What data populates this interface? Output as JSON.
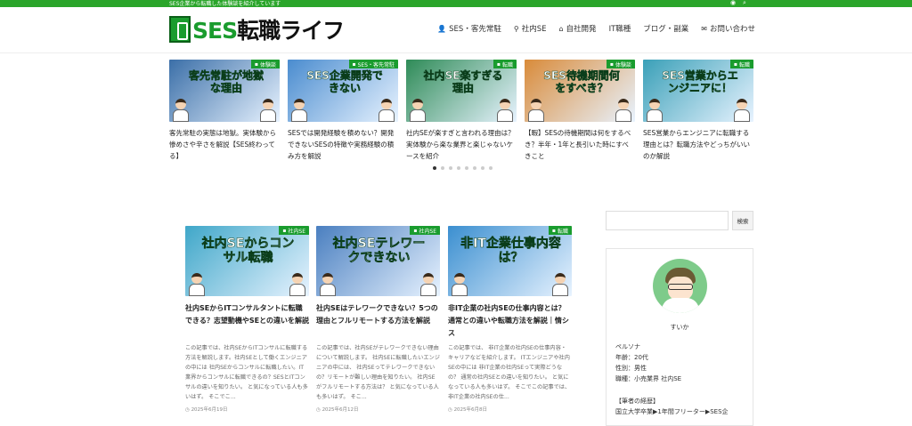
{
  "topbar": {
    "tagline": "SES企業から転職した体験談を紹介しています",
    "icons": [
      "rss-icon",
      "search-icon"
    ]
  },
  "header": {
    "logo_text": "SES転職ライフ",
    "nav": [
      {
        "label": "SES・客先常駐",
        "icon": "user-icon"
      },
      {
        "label": "社内SE",
        "icon": "pin-icon"
      },
      {
        "label": "自社開発",
        "icon": "home-icon"
      },
      {
        "label": "IT職種",
        "icon": ""
      },
      {
        "label": "ブログ・副業",
        "icon": ""
      },
      {
        "label": "お問い合わせ",
        "icon": "mail-icon"
      }
    ]
  },
  "slider": {
    "slides": [
      {
        "badge": "体験談",
        "thumb_text": "客先常駐が地獄な理由",
        "title": "客先常駐の実態は地獄。実体験から惨めさや辛さを解説【SES終わってる】",
        "bg": "#3b6fa8"
      },
      {
        "badge": "SES・客先常駐",
        "thumb_text": "SES企業開発できない",
        "title": "SESでは開発経験を積めない？開発できないSESの特徴や実務経験の積み方を解説",
        "bg": "#4a8ccf"
      },
      {
        "badge": "転職",
        "thumb_text": "社内SE楽すぎる理由",
        "title": "社内SEが楽すぎと言われる理由は？実体験から楽な業界と楽じゃないケースを紹介",
        "bg": "#2e8b57"
      },
      {
        "badge": "体験談",
        "thumb_text": "SES待機期間何をすべき？",
        "title": "【暇】SESの待機期間は何をするべき？半年・1年と長引いた時にすべきこと",
        "bg": "#d98b3a"
      },
      {
        "badge": "転職",
        "thumb_text": "SES営業からエンジニアに！",
        "title": "SES営業からエンジニアに転職する理由とは？転職方法やどっちがいいのか解説",
        "bg": "#3aa0b8"
      }
    ],
    "dots": 8,
    "active_dot": 0
  },
  "cards": [
    {
      "badge": "社内SE",
      "thumb_text": "社内SEからコンサル転職",
      "title": "社内SEからITコンサルタントに転職できる？志望動機やSEとの違いを解説",
      "excerpt": "この記事では、社内SEからITコンサルに転職する方法を解説します。社内SEとして働くエンジニアの中には 社内SEからコンサルに転職したい。IT業界からコンサルに転職できるの？SESとITコンサルの違いを知りたい。 と気になっている人も多いはず。 そこでこ...",
      "date": "2025年6月19日",
      "bg": "#3fa7c9"
    },
    {
      "badge": "社内SE",
      "thumb_text": "社内SEテレワークできない",
      "title": "社内SEはテレワークできない？5つの理由とフルリモートする方法を解説",
      "excerpt": "この記事では、社内SEがテレワークできない理由について解説します。 社内SEに転職したいエンジニアの中には、 社内SEってテレワークできないの？リモートが難しい理由を知りたい。 社内SEがフルリモートする方法は？ と気になっている人も多いはず。 そこ...",
      "date": "2025年6月12日",
      "bg": "#4a7fc0"
    },
    {
      "badge": "転職",
      "thumb_text": "非IT企業仕事内容は？",
      "title": "非IT企業の社内SEの仕事内容とは？通常との違いや転職方法を解説｜情シス",
      "excerpt": "この記事では、 非IT企業の社内SEの仕事内容・キャリアなどを紹介します。 ITエンジニアや社内SEの中には 非IT企業の社内SEって実際どうなの？ 通常の社内SEとの違いを知りたい。 と気になっている人も多いはず。 そこでこの記事では、 非IT企業の社内SEの仕...",
      "date": "2025年6月8日",
      "bg": "#3b8fd0"
    }
  ],
  "sidebar": {
    "search_button": "検索",
    "profile": {
      "name": "すいか",
      "persona": "ペルソナ",
      "age": "年齢：20代",
      "gender": "性別：男性",
      "job": "職種：小売業界 社内SE",
      "history_title": "【筆者の経歴】",
      "history": "国立大学卒業▶1年間フリーター▶SES企"
    }
  },
  "colors": {
    "brand": "#1a9c2e",
    "topbar": "#2aa52a"
  }
}
